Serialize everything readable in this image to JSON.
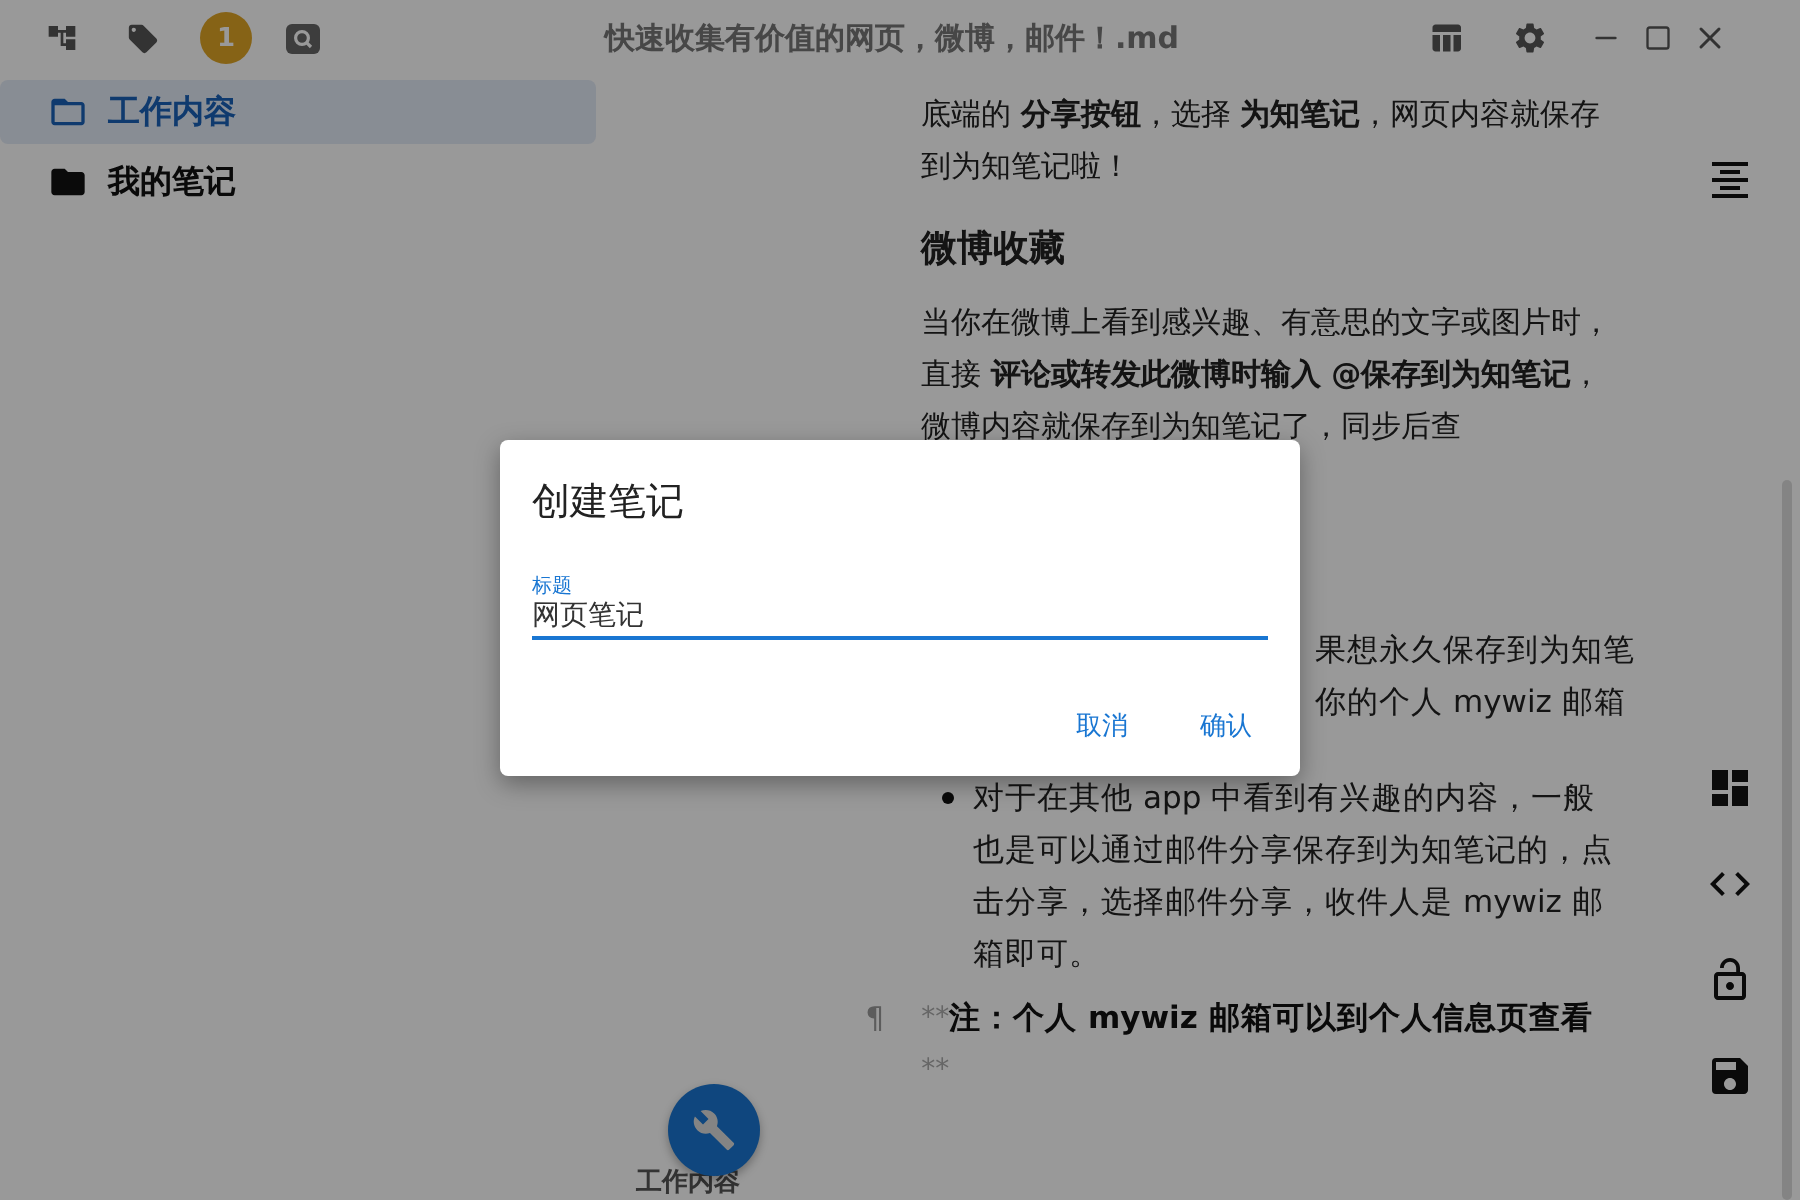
{
  "toolbar": {
    "badge": "1"
  },
  "window": {
    "title": "快速收集有价值的网页，微博，邮件！.md"
  },
  "sidebar": {
    "items": [
      {
        "label": "工作内容",
        "selected": true
      },
      {
        "label": "我的笔记",
        "selected": false
      }
    ]
  },
  "editor": {
    "blocks": [
      {
        "kind": "paragraph",
        "text": "底端的 **分享按钮**，选择 **为知笔记**，网页内容就保存到为知笔记啦！"
      },
      {
        "kind": "heading",
        "text": "微博收藏"
      },
      {
        "kind": "paragraph",
        "text": "当你在微博上看到感兴趣、有意思的文字或图片时，直接 **评论或转发此微博时输入 @保存到为知笔记**，微博内容就保存到为知笔记了，同步后查"
      },
      {
        "kind": "fragment",
        "text": "果想永久保存到为知笔"
      },
      {
        "kind": "fragment",
        "text": "你的个人 mywiz 邮箱"
      },
      {
        "kind": "bullet",
        "text": "对于在其他 app 中看到有兴趣的内容，一般也是可以通过邮件分享保存到为知笔记的，点击分享，选择邮件分享，收件人是 mywiz 邮箱即可。"
      },
      {
        "kind": "note",
        "pilcrow": "¶",
        "open": "**",
        "text": "注：个人 mywiz 邮箱可以到个人信息页查看",
        "close": "**"
      }
    ]
  },
  "footer": {
    "label": "工作内容"
  },
  "dialog": {
    "title": "创建笔记",
    "field": {
      "label": "标题",
      "value": "网页笔记",
      "focused": true
    },
    "buttons": [
      "取消",
      "确认"
    ]
  }
}
